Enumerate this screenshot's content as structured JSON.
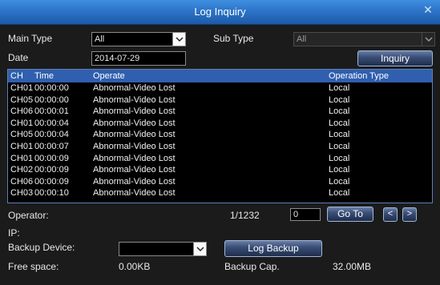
{
  "window": {
    "title": "Log Inquiry"
  },
  "filters": {
    "main_type_label": "Main Type",
    "main_type_value": "All",
    "sub_type_label": "Sub Type",
    "sub_type_value": "All",
    "date_label": "Date",
    "date_value": "2014-07-29",
    "inquiry_label": "Inquiry"
  },
  "log": {
    "columns": {
      "ch": "CH",
      "time": "Time",
      "operate": "Operate",
      "op_type": "Operation Type"
    },
    "rows": [
      {
        "ch": "CH01",
        "time": "00:00:00",
        "operate": "Abnormal-Video Lost",
        "op_type": "Local"
      },
      {
        "ch": "CH05",
        "time": "00:00:00",
        "operate": "Abnormal-Video Lost",
        "op_type": "Local"
      },
      {
        "ch": "CH06",
        "time": "00:00:01",
        "operate": "Abnormal-Video Lost",
        "op_type": "Local"
      },
      {
        "ch": "CH01",
        "time": "00:00:04",
        "operate": "Abnormal-Video Lost",
        "op_type": "Local"
      },
      {
        "ch": "CH05",
        "time": "00:00:04",
        "operate": "Abnormal-Video Lost",
        "op_type": "Local"
      },
      {
        "ch": "CH01",
        "time": "00:00:07",
        "operate": "Abnormal-Video Lost",
        "op_type": "Local"
      },
      {
        "ch": "CH01",
        "time": "00:00:09",
        "operate": "Abnormal-Video Lost",
        "op_type": "Local"
      },
      {
        "ch": "CH02",
        "time": "00:00:09",
        "operate": "Abnormal-Video Lost",
        "op_type": "Local"
      },
      {
        "ch": "CH06",
        "time": "00:00:09",
        "operate": "Abnormal-Video Lost",
        "op_type": "Local"
      },
      {
        "ch": "CH03",
        "time": "00:00:10",
        "operate": "Abnormal-Video Lost",
        "op_type": "Local"
      }
    ]
  },
  "pager": {
    "operator_label": "Operator:",
    "ip_label": "IP:",
    "page_info": "1/1232",
    "goto_value": "0",
    "goto_label": "Go To",
    "prev_label": "<",
    "next_label": ">"
  },
  "backup": {
    "device_label": "Backup Device:",
    "device_value": "",
    "log_backup_label": "Log Backup",
    "free_space_label": "Free space:",
    "free_space_value": "0.00KB",
    "backup_cap_label": "Backup Cap.",
    "backup_cap_value": "32.00MB"
  },
  "colors": {
    "titlebar": "#2d74c8",
    "header_row": "#2f5fae",
    "background": "#1b1b1b"
  }
}
